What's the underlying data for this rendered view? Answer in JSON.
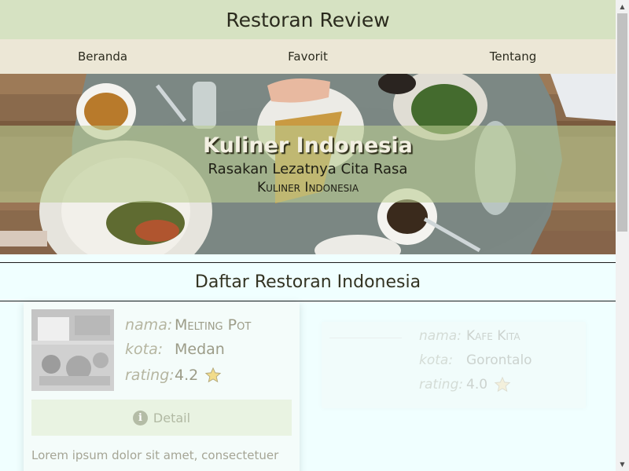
{
  "header": {
    "title": "Restoran Review"
  },
  "nav": {
    "items": [
      "Beranda",
      "Favorit",
      "Tentang"
    ]
  },
  "hero": {
    "title": "Kuliner Indonesia",
    "subtitle": "Rasakan Lezatnya Cita Rasa",
    "tagline": "Kuliner Indonesia"
  },
  "section": {
    "title": "Daftar Restoran Indonesia"
  },
  "labels": {
    "name": "nama:",
    "city": "kota:",
    "rating": "rating:"
  },
  "restaurants": [
    {
      "name": "Melting Pot",
      "city": "Medan",
      "rating": "4.2",
      "detail_label": "Detail",
      "description": "Lorem ipsum dolor sit amet, consectetuer"
    },
    {
      "name": "Kafe Kita",
      "city": "Gorontalo",
      "rating": "4.0"
    }
  ],
  "icons": {
    "rating": "star-icon",
    "detail": "info-icon",
    "scroll_up": "arrow-up-icon",
    "scroll_down": "arrow-down-icon"
  },
  "colors": {
    "header_bg": "#d6e2c2",
    "nav_bg": "#ece7d6",
    "page_bg": "#f0ffff",
    "star": "#f2dc8a"
  }
}
